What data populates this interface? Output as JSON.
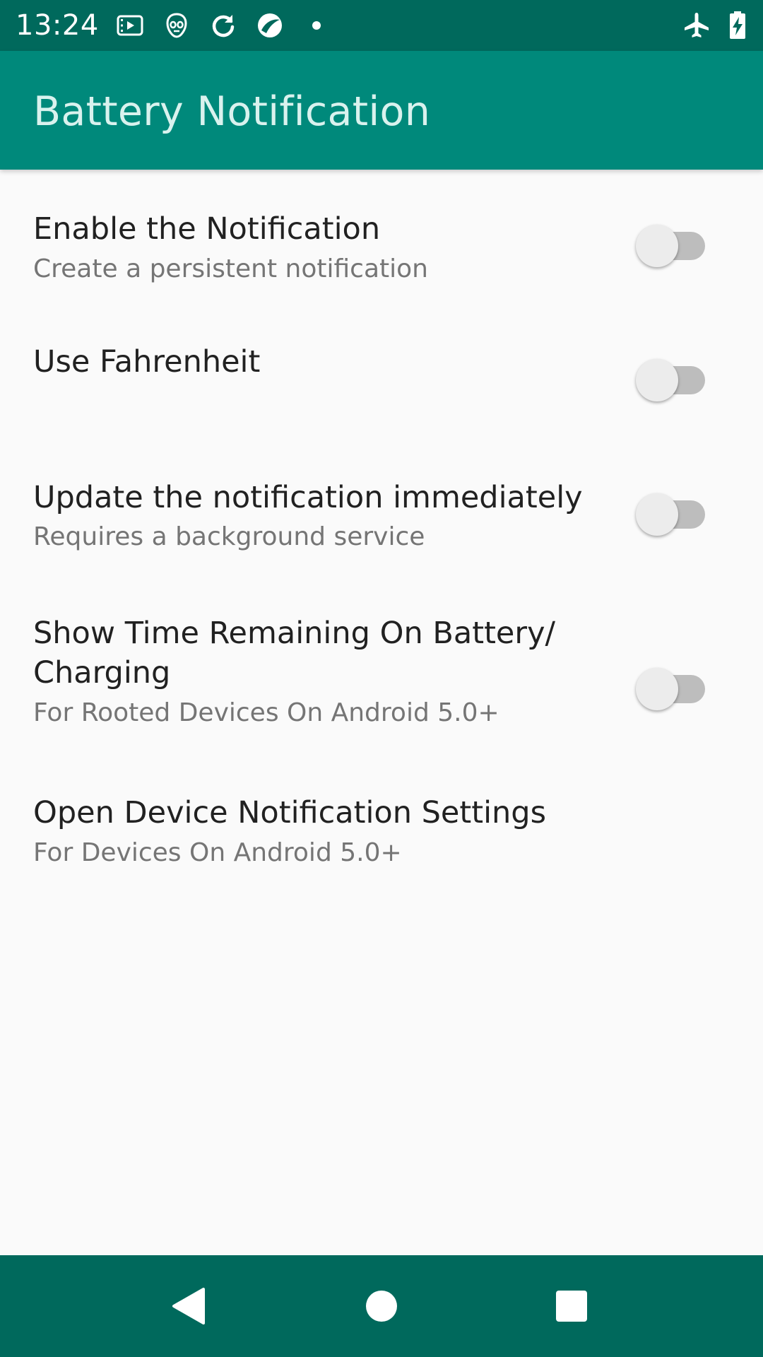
{
  "status_bar": {
    "time": "13:24",
    "left_icons": [
      "media-icon",
      "alien-icon",
      "sync-icon",
      "app-circle-icon",
      "dot-icon"
    ],
    "right_icons": [
      "airplane-icon",
      "battery-charging-icon"
    ],
    "color": "#00695c"
  },
  "app_bar": {
    "title": "Battery Notification",
    "color": "#00897b"
  },
  "settings": [
    {
      "title": "Enable the Notification",
      "summary": "Create a persistent notification",
      "switch_on": false
    },
    {
      "title": "Use Fahrenheit",
      "summary": "",
      "switch_on": false
    },
    {
      "title": "Update the notification immediately",
      "summary": "Requires a background service",
      "switch_on": false
    },
    {
      "title": "Show Time Remaining On Battery/ Charging",
      "summary": "For Rooted Devices On Android 5.0+",
      "switch_on": false
    },
    {
      "title": "Open Device Notification Settings",
      "summary": "For Devices On Android 5.0+"
    }
  ],
  "nav_bar": {
    "buttons": [
      "back-icon",
      "home-icon",
      "recents-icon"
    ],
    "color": "#00695c"
  }
}
